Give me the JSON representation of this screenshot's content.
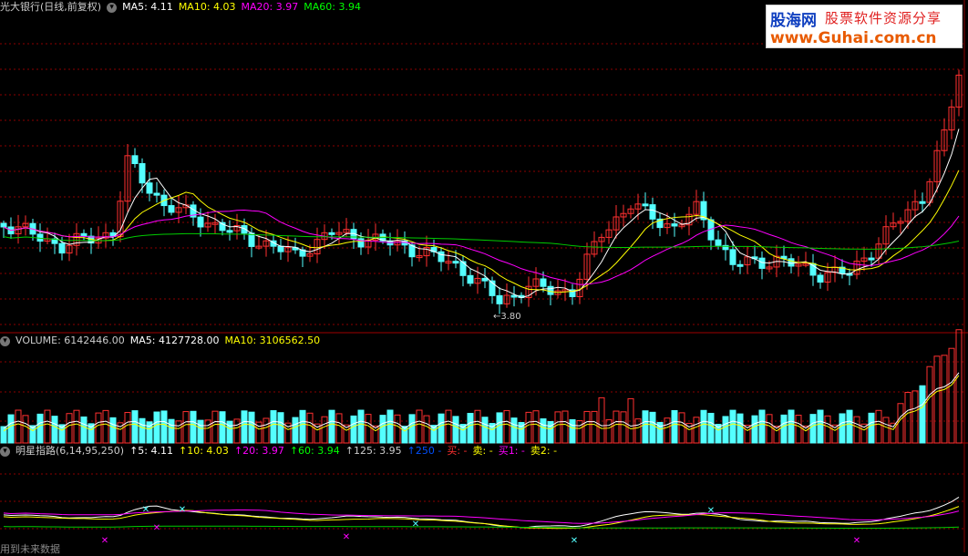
{
  "main_panel": {
    "title": "光大银行(日线,前复权)",
    "items": [
      {
        "text": "MA5: 4.11",
        "color": "#ffffff"
      },
      {
        "text": "MA10: 4.03",
        "color": "#ffff00"
      },
      {
        "text": "MA20: 3.97",
        "color": "#ff00ff"
      },
      {
        "text": "MA60: 3.94",
        "color": "#00ff00"
      }
    ],
    "low_label": "←3.80"
  },
  "volume_panel": {
    "items": [
      {
        "text": "VOLUME: 6142446.00",
        "color": "#cccccc"
      },
      {
        "text": "MA5: 4127728.00",
        "color": "#ffffff"
      },
      {
        "text": "MA10: 3106562.50",
        "color": "#ffff00"
      }
    ]
  },
  "indicator_panel": {
    "title": "明星指路(6,14,95,250)",
    "items": [
      {
        "text": "↑5: 4.11",
        "color": "#ffffff"
      },
      {
        "text": "↑10: 4.03",
        "color": "#ffff00"
      },
      {
        "text": "↑20: 3.97",
        "color": "#ff00ff"
      },
      {
        "text": "↑60: 3.94",
        "color": "#00ff00"
      },
      {
        "text": "↑125: 3.95",
        "color": "#cccccc"
      },
      {
        "text": "↑250 -",
        "color": "#0050ff"
      },
      {
        "text": "买: -",
        "color": "#ff3030"
      },
      {
        "text": "卖: -",
        "color": "#ffff00"
      },
      {
        "text": "买1: -",
        "color": "#ff00ff"
      },
      {
        "text": "卖2: -",
        "color": "#ffff00"
      }
    ]
  },
  "watermark": {
    "name": "股海网",
    "slogan": "股票软件资源分享",
    "url": "www.Guhai.com.cn"
  },
  "bottom_note": "用到未来数据",
  "colors": {
    "up": "#ff3030",
    "down": "#54ffff",
    "grid": "#8b0000"
  }
}
